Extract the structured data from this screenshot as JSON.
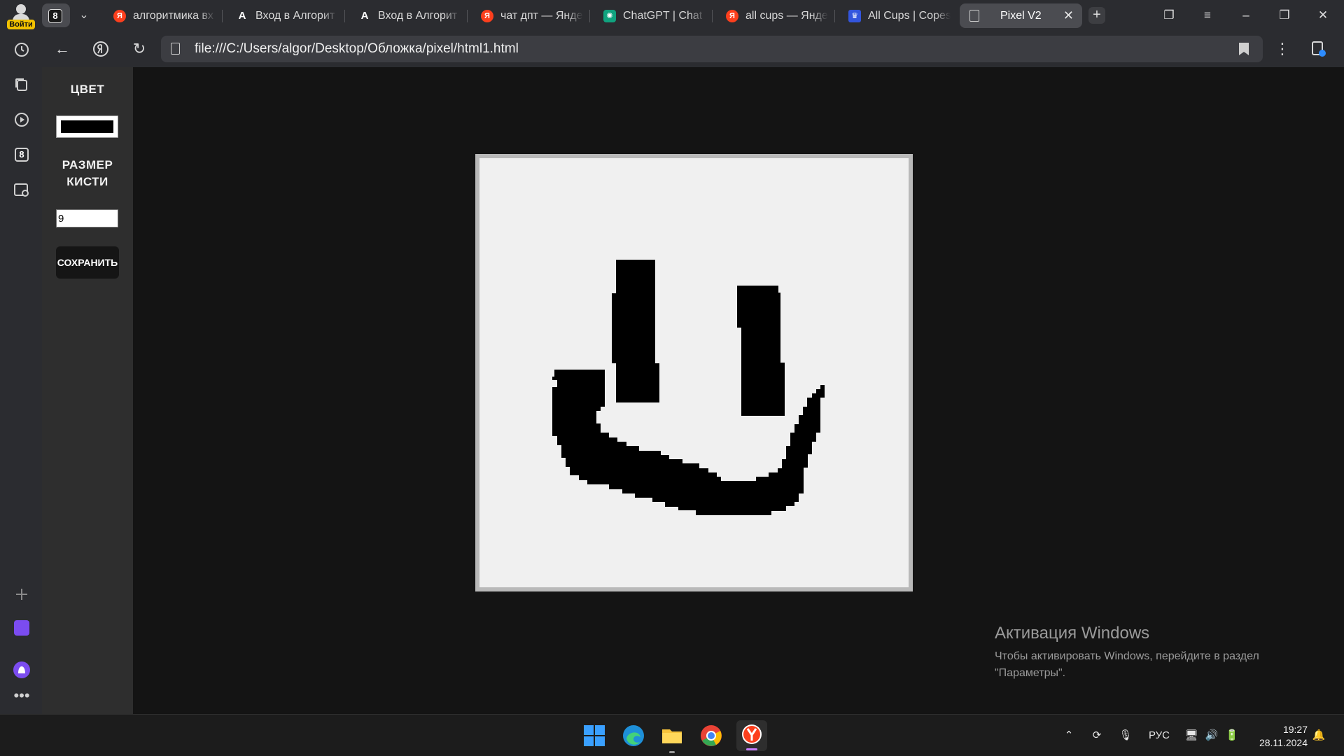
{
  "browser": {
    "profile_badge": "Войти",
    "tab_group_count": "8",
    "tabs": [
      {
        "title": "алгоритмика вх",
        "favicon": "yandex-icon"
      },
      {
        "title": "Вход в Алгорит",
        "favicon": "algorithmika-icon"
      },
      {
        "title": "Вход в Алгорит",
        "favicon": "algorithmika-icon"
      },
      {
        "title": "чат дпт — Янде",
        "favicon": "yandex-icon"
      },
      {
        "title": "ChatGPT | Chat",
        "favicon": "chatgpt-icon"
      },
      {
        "title": "all cups — Янде",
        "favicon": "yandex-icon"
      },
      {
        "title": "All Cups | Copes",
        "favicon": "allcups-icon"
      },
      {
        "title": "Pixel V2",
        "favicon": "document-icon",
        "active": true
      }
    ],
    "url": "file:///C:/Users/algor/Desktop/Обложка/pixel/html1.html",
    "sidebar_badge": "8"
  },
  "app": {
    "color_label": "ЦВЕТ",
    "color_value": "#000000",
    "brush_label_line1": "РАЗМЕР",
    "brush_label_line2": "КИСТИ",
    "brush_size": "9",
    "save_label": "СОХРАНИТЬ",
    "canvas_background": "#f0f0f0"
  },
  "watermark": {
    "title": "Активация Windows",
    "line1": "Чтобы активировать Windows, перейдите в раздел",
    "line2": "\"Параметры\"."
  },
  "taskbar": {
    "language": "РУС",
    "time": "19:27",
    "date": "28.11.2024"
  },
  "colors": {
    "accent_yandex": "#fc3f1d",
    "profile_badge": "#f2c200",
    "page_bg": "#141414",
    "panel_bg": "#2e2e2e"
  }
}
